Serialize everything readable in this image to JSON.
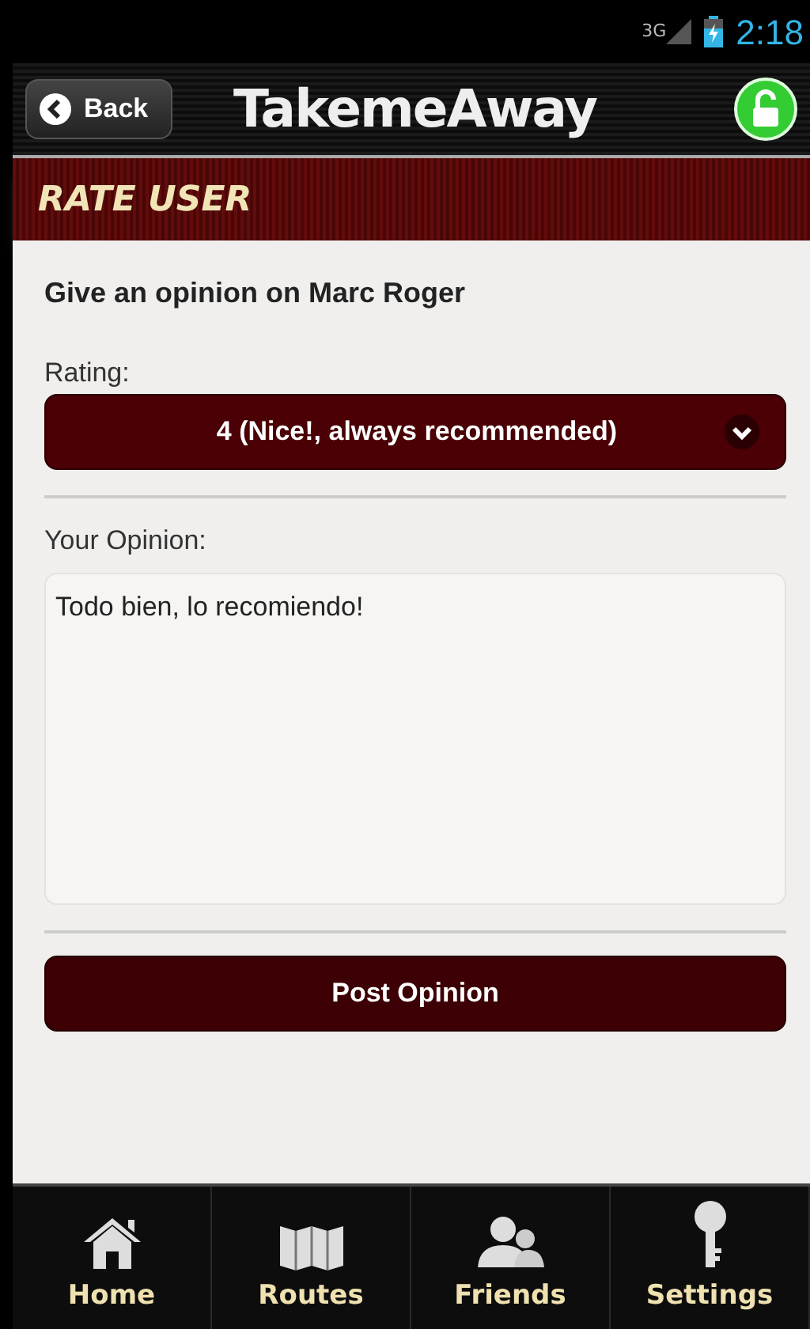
{
  "status_bar": {
    "network": "3G",
    "time": "2:18"
  },
  "header": {
    "back": "Back",
    "title": "TakemeAway"
  },
  "section": {
    "title": "RATE USER"
  },
  "form": {
    "heading": "Give an opinion on Marc Roger",
    "rating_label": "Rating:",
    "rating_value": "4 (Nice!, always recommended)",
    "opinion_label": "Your Opinion:",
    "opinion_value": "Todo bien, lo recomiendo!",
    "submit": "Post Opinion"
  },
  "tabs": [
    {
      "label": "Home",
      "kind": "home"
    },
    {
      "label": "Routes",
      "kind": "routes"
    },
    {
      "label": "Friends",
      "kind": "friends"
    },
    {
      "label": "Settings",
      "kind": "settings"
    }
  ]
}
